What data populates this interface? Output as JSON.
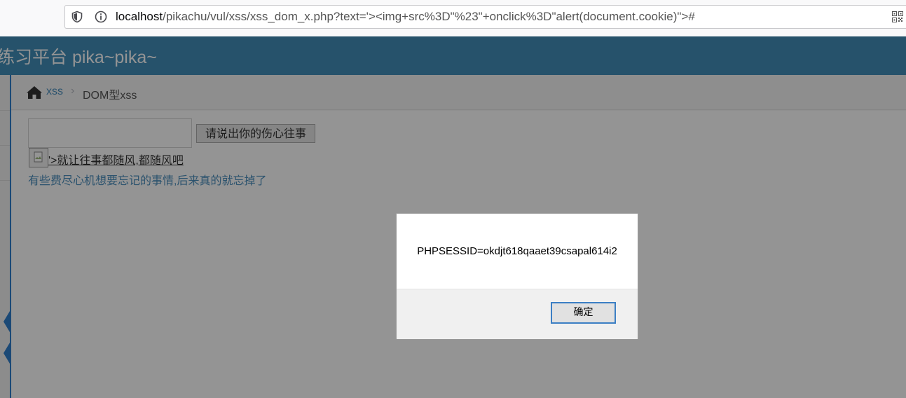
{
  "browser": {
    "url_host": "localhost",
    "url_path": "/pikachu/vul/xss/xss_dom_x.php?text='><img+src%3D\"%23\"+onclick%3D\"alert(document.cookie)\">#"
  },
  "navbar": {
    "brand": "练习平台 pika~pika~"
  },
  "breadcrumb": {
    "link": "xss",
    "separator": "›",
    "current": "DOM型xss"
  },
  "form": {
    "input_value": "",
    "button_label": "请说出你的伤心往事"
  },
  "output": {
    "link_text": "'>就让往事都随风,都随风吧",
    "message": "有些费尽心机想要忘记的事情,后来真的就忘掉了"
  },
  "alert": {
    "message": "PHPSESSID=okdjt618qaaet39csapal614i2",
    "ok_label": "确定"
  },
  "colors": {
    "navbar": "#438eb9",
    "link": "#4c8fbd",
    "sidebar_accent": "#307ecc"
  }
}
